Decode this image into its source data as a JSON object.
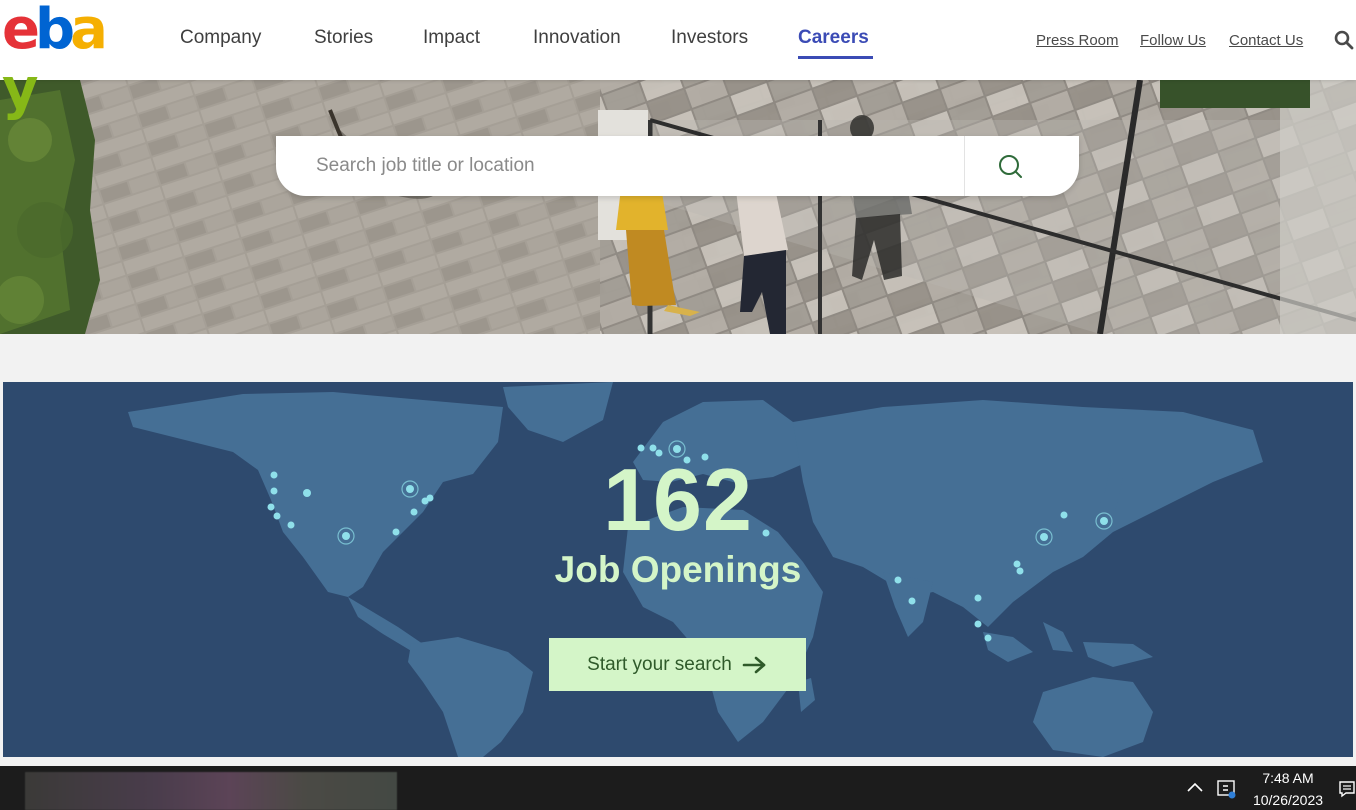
{
  "header": {
    "logo_letters": [
      {
        "char": "e",
        "color": "#e53238"
      },
      {
        "char": "b",
        "color": "#0064d2"
      },
      {
        "char": "a",
        "color": "#f5af02"
      },
      {
        "char": "y",
        "color": "#86b817"
      }
    ],
    "nav": [
      {
        "label": "Company",
        "active": false
      },
      {
        "label": "Stories",
        "active": false
      },
      {
        "label": "Impact",
        "active": false
      },
      {
        "label": "Innovation",
        "active": false
      },
      {
        "label": "Investors",
        "active": false
      },
      {
        "label": "Careers",
        "active": true
      }
    ],
    "utility_links": [
      "Press Room",
      "Follow Us",
      "Contact Us"
    ],
    "search_icon": "search-icon"
  },
  "hero": {
    "search_placeholder": "Search job title or location",
    "search_icon": "search-icon"
  },
  "jobs": {
    "count": "162",
    "label": "Job Openings",
    "cta_label": "Start your search",
    "cta_icon": "arrow-right-icon"
  },
  "taskbar": {
    "time": "7:48 AM",
    "date": "10/26/2023",
    "tray_icons": [
      "chevron-up-icon",
      "app-tray-icon",
      "notification-icon"
    ]
  },
  "colors": {
    "accent": "#3b4bb5",
    "band_bg": "#2e4a6e",
    "highlight": "#d4f5c8"
  }
}
